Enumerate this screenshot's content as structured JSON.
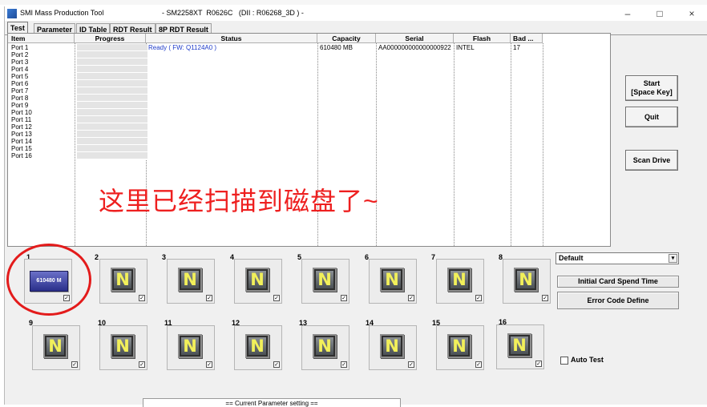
{
  "top_strip_text": "",
  "window": {
    "app_name": "SMI Mass Production Tool",
    "title": "- SM2258XT  R0626C   (DII : R06268_3D ) -",
    "controls": {
      "minimize": "–",
      "maximize": "□",
      "close": "×"
    }
  },
  "tabs": [
    "Test",
    "Parameter",
    "ID Table",
    "RDT Result",
    "8P RDT Result"
  ],
  "table": {
    "columns": [
      "Item",
      "Progress",
      "Status",
      "Capacity",
      "Serial",
      "Flash",
      "Bad ..."
    ],
    "ports": [
      "Port 1",
      "Port 2",
      "Port 3",
      "Port 4",
      "Port 5",
      "Port 6",
      "Port 7",
      "Port 8",
      "Port 9",
      "Port 10",
      "Port 11",
      "Port 12",
      "Port 13",
      "Port 14",
      "Port 15",
      "Port 16"
    ],
    "row1": {
      "status": "Ready ( FW: Q1124A0 )",
      "capacity": "610480 MB",
      "serial": "AA000000000000000922",
      "flash": "INTEL",
      "bad": "17"
    }
  },
  "annotation": "这里已经扫描到磁盘了~",
  "buttons": {
    "start": "Start",
    "start_hint": "[Space Key]",
    "quit": "Quit",
    "scan": "Scan Drive"
  },
  "slots": [
    {
      "num": "1",
      "label": "610480 M"
    },
    {
      "num": "2",
      "label": "N"
    },
    {
      "num": "3",
      "label": "N"
    },
    {
      "num": "4",
      "label": "N"
    },
    {
      "num": "5",
      "label": "N"
    },
    {
      "num": "6",
      "label": "N"
    },
    {
      "num": "7",
      "label": "N"
    },
    {
      "num": "8",
      "label": "N"
    },
    {
      "num": "9",
      "label": "N"
    },
    {
      "num": "10",
      "label": "N"
    },
    {
      "num": "11",
      "label": "N"
    },
    {
      "num": "12",
      "label": "N"
    },
    {
      "num": "13",
      "label": "N"
    },
    {
      "num": "14",
      "label": "N"
    },
    {
      "num": "15",
      "label": "N"
    },
    {
      "num": "16",
      "label": "N"
    }
  ],
  "slot_check_mark": "✓",
  "right_panel": {
    "profile": "Default",
    "profile_arrow": "▾",
    "initial_card": "Initial Card Spend Time",
    "error_code": "Error Code Define",
    "auto_test": "Auto Test"
  },
  "bottom_panel": "== Current Parameter setting =="
}
